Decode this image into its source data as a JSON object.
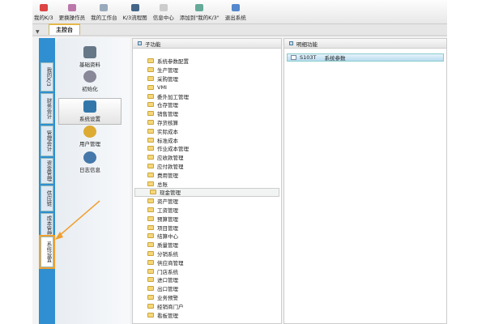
{
  "toolbar": [
    "我的K/3",
    "更换操作员",
    "我的工作台",
    "K/3流程图",
    "信息中心",
    "添加到\"我的K/3\"",
    "退出系统"
  ],
  "main_tab": "主控台",
  "left_tabs": [
    "我的K/3",
    "财务会计",
    "管理会计",
    "资金管理",
    "供应链",
    "成本管理",
    "系统设置"
  ],
  "modules": [
    "基础资料",
    "初始化",
    "系统设置",
    "用户管理",
    "日志信息"
  ],
  "sub_panel": {
    "title": "子功能",
    "items": [
      "系统参数配置",
      "生产管理",
      "采购管理",
      "VMI",
      "委外加工管理",
      "仓存管理",
      "销售管理",
      "存货核算",
      "实际成本",
      "标准成本",
      "作业成本管理",
      "应收款管理",
      "应付款管理",
      "费用管理",
      "总账",
      "现金管理",
      "资产管理",
      "工资管理",
      "预算管理",
      "项目管理",
      "结算中心",
      "质量管理",
      "分销系统",
      "供应商管理",
      "门店系统",
      "进口管理",
      "出口管理",
      "业务预警",
      "经销商门户",
      "看板管理"
    ],
    "selected": "现金管理"
  },
  "detail_panel": {
    "title": "明细功能",
    "items": [
      {
        "code": "S103T",
        "name": "系统参数"
      }
    ]
  },
  "colors": {
    "sidebar": "#2f8fd0",
    "highlight": "#f0a030"
  }
}
